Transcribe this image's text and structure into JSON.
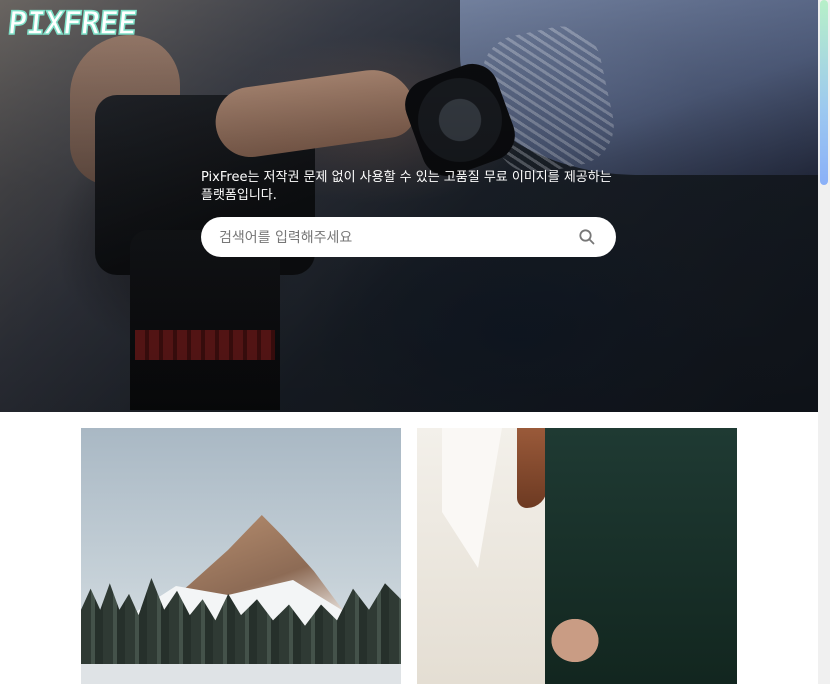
{
  "brand": {
    "logo_text": "PIXFREE"
  },
  "hero": {
    "tagline": "PixFree는 저작권 문제 없이 사용할 수 있는 고품질 무료 이미지를 제공하는 플랫폼입니다.",
    "search": {
      "placeholder": "검색어를 입력해주세요",
      "value": "",
      "button_icon": "search-icon"
    }
  },
  "colors": {
    "logo_outline": "#7fe0c8",
    "scrollbar_thumb": "#9cc8f0"
  },
  "gallery": {
    "items": [
      {
        "subject": "mountain",
        "icon": "mountain-photo"
      },
      {
        "subject": "couple holding hands",
        "icon": "couple-photo"
      }
    ]
  }
}
